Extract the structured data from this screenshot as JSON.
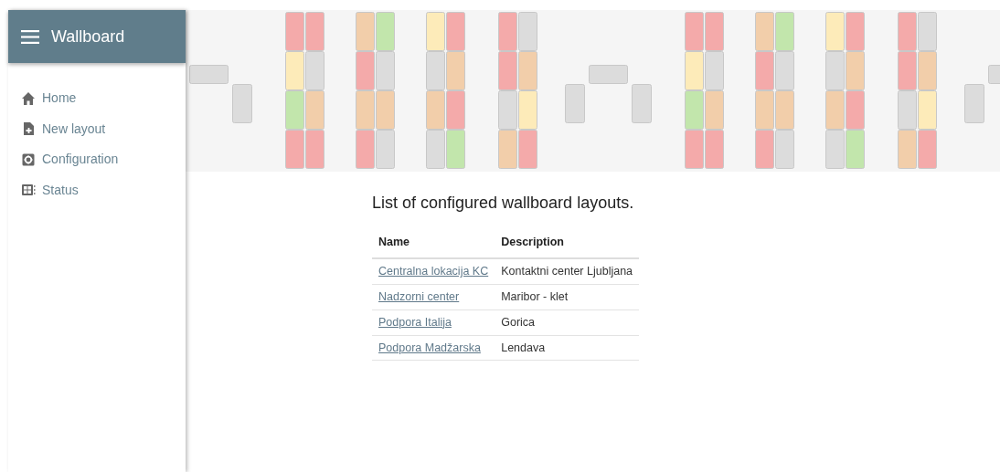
{
  "app": {
    "title": "Wallboard"
  },
  "sidebar": {
    "items": [
      {
        "label": "Home",
        "kind": "home"
      },
      {
        "label": "New layout",
        "kind": "new"
      },
      {
        "label": "Configuration",
        "kind": "config"
      },
      {
        "label": "Status",
        "kind": "status"
      }
    ]
  },
  "content": {
    "heading": "List of configured wallboard layouts.",
    "table": {
      "columns": [
        "Name",
        "Description"
      ],
      "rows": [
        {
          "name": "Centralna lokacija KC",
          "description": "Kontaktni center Ljubljana"
        },
        {
          "name": "Nadzorni center",
          "description": "Maribor - klet"
        },
        {
          "name": "Podpora Italija",
          "description": "Gorica"
        },
        {
          "name": "Podpora Madžarska",
          "description": "Lendava"
        }
      ]
    }
  }
}
